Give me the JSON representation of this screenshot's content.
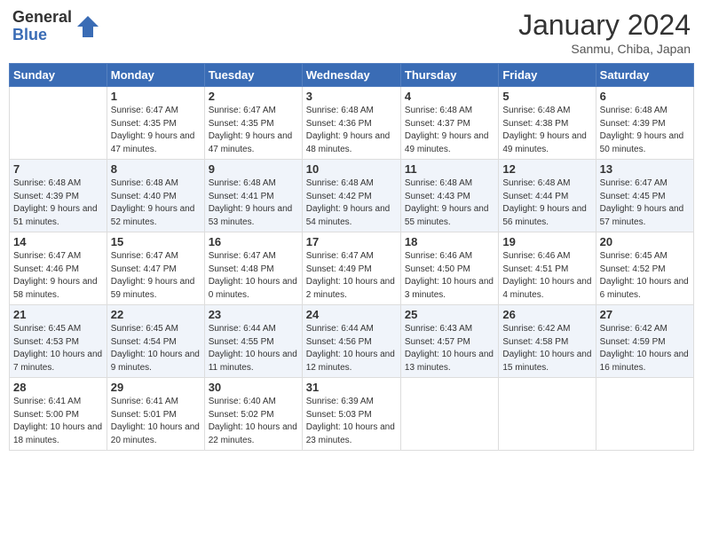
{
  "header": {
    "logo_general": "General",
    "logo_blue": "Blue",
    "month_year": "January 2024",
    "location": "Sanmu, Chiba, Japan"
  },
  "days_of_week": [
    "Sunday",
    "Monday",
    "Tuesday",
    "Wednesday",
    "Thursday",
    "Friday",
    "Saturday"
  ],
  "weeks": [
    [
      {
        "day": "",
        "info": ""
      },
      {
        "day": "1",
        "info": "Sunrise: 6:47 AM\nSunset: 4:35 PM\nDaylight: 9 hours and 47 minutes."
      },
      {
        "day": "2",
        "info": "Sunrise: 6:47 AM\nSunset: 4:35 PM\nDaylight: 9 hours and 47 minutes."
      },
      {
        "day": "3",
        "info": "Sunrise: 6:48 AM\nSunset: 4:36 PM\nDaylight: 9 hours and 48 minutes."
      },
      {
        "day": "4",
        "info": "Sunrise: 6:48 AM\nSunset: 4:37 PM\nDaylight: 9 hours and 49 minutes."
      },
      {
        "day": "5",
        "info": "Sunrise: 6:48 AM\nSunset: 4:38 PM\nDaylight: 9 hours and 49 minutes."
      },
      {
        "day": "6",
        "info": "Sunrise: 6:48 AM\nSunset: 4:39 PM\nDaylight: 9 hours and 50 minutes."
      }
    ],
    [
      {
        "day": "7",
        "info": "Sunrise: 6:48 AM\nSunset: 4:39 PM\nDaylight: 9 hours and 51 minutes."
      },
      {
        "day": "8",
        "info": "Sunrise: 6:48 AM\nSunset: 4:40 PM\nDaylight: 9 hours and 52 minutes."
      },
      {
        "day": "9",
        "info": "Sunrise: 6:48 AM\nSunset: 4:41 PM\nDaylight: 9 hours and 53 minutes."
      },
      {
        "day": "10",
        "info": "Sunrise: 6:48 AM\nSunset: 4:42 PM\nDaylight: 9 hours and 54 minutes."
      },
      {
        "day": "11",
        "info": "Sunrise: 6:48 AM\nSunset: 4:43 PM\nDaylight: 9 hours and 55 minutes."
      },
      {
        "day": "12",
        "info": "Sunrise: 6:48 AM\nSunset: 4:44 PM\nDaylight: 9 hours and 56 minutes."
      },
      {
        "day": "13",
        "info": "Sunrise: 6:47 AM\nSunset: 4:45 PM\nDaylight: 9 hours and 57 minutes."
      }
    ],
    [
      {
        "day": "14",
        "info": "Sunrise: 6:47 AM\nSunset: 4:46 PM\nDaylight: 9 hours and 58 minutes."
      },
      {
        "day": "15",
        "info": "Sunrise: 6:47 AM\nSunset: 4:47 PM\nDaylight: 9 hours and 59 minutes."
      },
      {
        "day": "16",
        "info": "Sunrise: 6:47 AM\nSunset: 4:48 PM\nDaylight: 10 hours and 0 minutes."
      },
      {
        "day": "17",
        "info": "Sunrise: 6:47 AM\nSunset: 4:49 PM\nDaylight: 10 hours and 2 minutes."
      },
      {
        "day": "18",
        "info": "Sunrise: 6:46 AM\nSunset: 4:50 PM\nDaylight: 10 hours and 3 minutes."
      },
      {
        "day": "19",
        "info": "Sunrise: 6:46 AM\nSunset: 4:51 PM\nDaylight: 10 hours and 4 minutes."
      },
      {
        "day": "20",
        "info": "Sunrise: 6:45 AM\nSunset: 4:52 PM\nDaylight: 10 hours and 6 minutes."
      }
    ],
    [
      {
        "day": "21",
        "info": "Sunrise: 6:45 AM\nSunset: 4:53 PM\nDaylight: 10 hours and 7 minutes."
      },
      {
        "day": "22",
        "info": "Sunrise: 6:45 AM\nSunset: 4:54 PM\nDaylight: 10 hours and 9 minutes."
      },
      {
        "day": "23",
        "info": "Sunrise: 6:44 AM\nSunset: 4:55 PM\nDaylight: 10 hours and 11 minutes."
      },
      {
        "day": "24",
        "info": "Sunrise: 6:44 AM\nSunset: 4:56 PM\nDaylight: 10 hours and 12 minutes."
      },
      {
        "day": "25",
        "info": "Sunrise: 6:43 AM\nSunset: 4:57 PM\nDaylight: 10 hours and 13 minutes."
      },
      {
        "day": "26",
        "info": "Sunrise: 6:42 AM\nSunset: 4:58 PM\nDaylight: 10 hours and 15 minutes."
      },
      {
        "day": "27",
        "info": "Sunrise: 6:42 AM\nSunset: 4:59 PM\nDaylight: 10 hours and 16 minutes."
      }
    ],
    [
      {
        "day": "28",
        "info": "Sunrise: 6:41 AM\nSunset: 5:00 PM\nDaylight: 10 hours and 18 minutes."
      },
      {
        "day": "29",
        "info": "Sunrise: 6:41 AM\nSunset: 5:01 PM\nDaylight: 10 hours and 20 minutes."
      },
      {
        "day": "30",
        "info": "Sunrise: 6:40 AM\nSunset: 5:02 PM\nDaylight: 10 hours and 22 minutes."
      },
      {
        "day": "31",
        "info": "Sunrise: 6:39 AM\nSunset: 5:03 PM\nDaylight: 10 hours and 23 minutes."
      },
      {
        "day": "",
        "info": ""
      },
      {
        "day": "",
        "info": ""
      },
      {
        "day": "",
        "info": ""
      }
    ]
  ]
}
